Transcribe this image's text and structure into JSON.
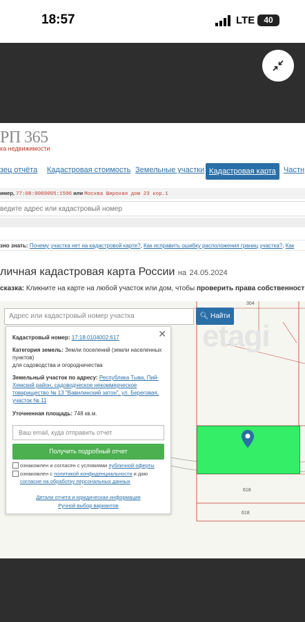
{
  "status_bar": {
    "time": "18:57",
    "network": "LTE",
    "battery": "40"
  },
  "site": {
    "logo": "РП 365",
    "logo_sub": "ка недвижимости"
  },
  "nav": {
    "items": [
      "зец отчёта",
      "Кадастровая стоимость",
      "Земельные участки",
      "Кадастровая карта",
      "Частн"
    ],
    "active_index": 3
  },
  "example_bar": {
    "prefix": "имер, ",
    "code": "77:08:0009005:1596",
    "or": " или ",
    "address": "Москва Широкая дом 23 кор.1"
  },
  "top_search": {
    "placeholder": "ведите адрес или кадастровый номер"
  },
  "useful": {
    "prefix": "зно знать:",
    "link1": "Почему участка нет на кадастровой карте?",
    "link2": "Как исправить ошибку расположения границ участка?",
    "link3": "Как"
  },
  "page": {
    "title": "личная кадастровая карта России",
    "date_prefix": "на",
    "date": "24.05.2024",
    "hint_label": "сказка:",
    "hint_text": " Кликните на карте на любой участок или дом, чтобы ",
    "hint_bold": "проверить права собственности и о"
  },
  "map": {
    "watermark": "etagi",
    "search_placeholder": "Адрес или кадастровый номер участка",
    "find_button": "Найти",
    "labels": [
      "304",
      "618",
      "618"
    ]
  },
  "popup": {
    "cad_label": "Кадастровый номер:",
    "cad_value": "17:18:0104002:617",
    "category_label": "Категория земель:",
    "category_value": "Земли поселений (земли населенных пунктов)",
    "category_line2": "для садоводства и огородничества",
    "address_label": "Земельный участок по адресу:",
    "address_value": "Республика Тыва, Пий-Хемский район, садоводческое некоммерческое товарищество № 13 \"Вавилинский затон\", ул. Береговая, участок № 11",
    "area_label": "Уточненная площадь:",
    "area_value": "748 кв.м.",
    "email_placeholder": "Ваш email, куда отправить отчет",
    "get_report_button": "Получить подробный отчет",
    "consent1_text": "ознакомлен и согласен с условиями ",
    "consent1_link": "публичной оферты",
    "consent2_text": "ознакомлен с ",
    "consent2_link": "политикой конфиденциальности",
    "consent2_text2": " и даю",
    "consent2_link2": "согласие на обработку персональных данных",
    "details_link": "Детали отчета и юридическая информация",
    "manual_link": "Ручной выбор вариантов"
  },
  "colors": {
    "link": "#2a6fa8",
    "parcel": "#33ee66",
    "button_green": "#4caf50",
    "pin": "#2a6fa8"
  }
}
